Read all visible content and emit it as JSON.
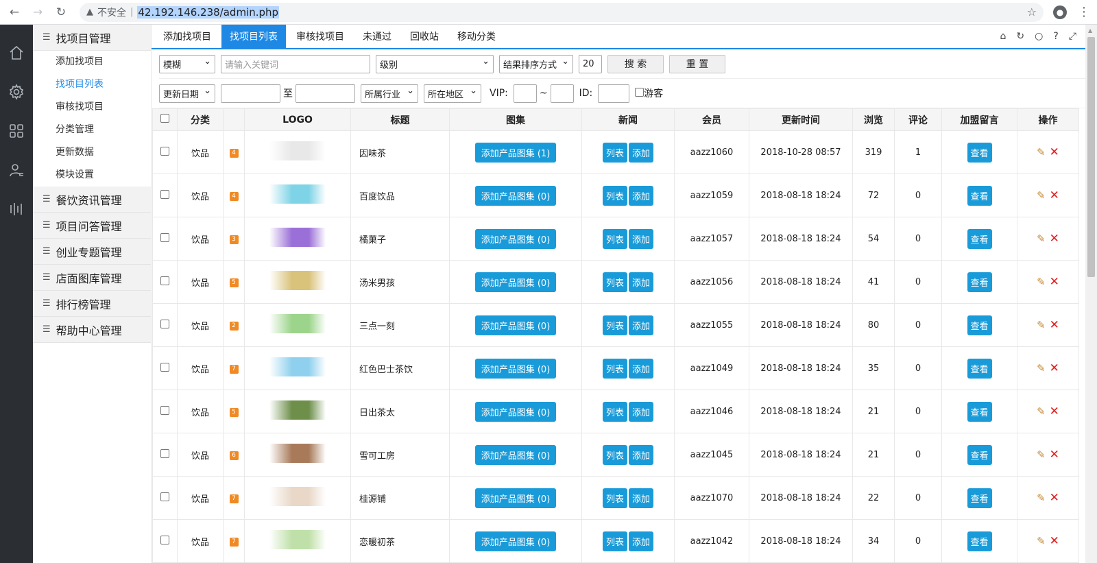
{
  "browser": {
    "insecure_label": "不安全",
    "url": "42.192.146.238/admin.php"
  },
  "iconbar": [
    "home-icon",
    "gear-icon",
    "grid-icon",
    "user-list-icon",
    "bars-icon"
  ],
  "sidebar": {
    "groups": [
      {
        "label": "找项目管理",
        "items": [
          "添加找项目",
          "找项目列表",
          "审核找项目",
          "分类管理",
          "更新数据",
          "模块设置"
        ]
      },
      {
        "label": "餐饮资讯管理"
      },
      {
        "label": "项目问答管理"
      },
      {
        "label": "创业专题管理"
      },
      {
        "label": "店面图库管理"
      },
      {
        "label": "排行榜管理"
      },
      {
        "label": "帮助中心管理"
      }
    ]
  },
  "tabs": [
    "添加找项目",
    "找项目列表",
    "审核找项目",
    "未通过",
    "回收站",
    "移动分类"
  ],
  "filters": {
    "mode": "模糊",
    "keyword_placeholder": "请输入关键词",
    "level": "级别",
    "sort": "结果排序方式",
    "pagesize": "20",
    "search_btn": "搜 索",
    "reset_btn": "重 置",
    "date_field": "更新日期",
    "to_label": "至",
    "industry": "所属行业",
    "region": "所在地区",
    "vip_label": "VIP:",
    "tilde": "~",
    "id_label": "ID:",
    "guest_label": "游客"
  },
  "table": {
    "headers": [
      "分类",
      "LOGO",
      "标题",
      "图集",
      "新闻",
      "会员",
      "更新时间",
      "浏览",
      "评论",
      "加盟留言",
      "操作"
    ],
    "list_label": "列表",
    "add_label": "添加",
    "view_label": "查看",
    "rows": [
      {
        "cat": "饮品",
        "rank": "4",
        "title": "因味茶",
        "gallery": "添加产品图集 (1)",
        "member": "aazz1060",
        "time": "2018-10-28 08:57",
        "views": "319",
        "comments": "1",
        "logo": "#e8e8e8"
      },
      {
        "cat": "饮品",
        "rank": "4",
        "title": "百度饮品",
        "gallery": "添加产品图集 (0)",
        "member": "aazz1059",
        "time": "2018-08-18 18:24",
        "views": "72",
        "comments": "0",
        "logo": "#7fd3e6"
      },
      {
        "cat": "饮品",
        "rank": "3",
        "title": "橘菓子",
        "gallery": "添加产品图集 (0)",
        "member": "aazz1057",
        "time": "2018-08-18 18:24",
        "views": "54",
        "comments": "0",
        "logo": "#9b6fd8"
      },
      {
        "cat": "饮品",
        "rank": "5",
        "title": "汤米男孩",
        "gallery": "添加产品图集 (0)",
        "member": "aazz1056",
        "time": "2018-08-18 18:24",
        "views": "41",
        "comments": "0",
        "logo": "#d9c27a"
      },
      {
        "cat": "饮品",
        "rank": "2",
        "title": "三点一刻",
        "gallery": "添加产品图集 (0)",
        "member": "aazz1055",
        "time": "2018-08-18 18:24",
        "views": "80",
        "comments": "0",
        "logo": "#9bd48a"
      },
      {
        "cat": "饮品",
        "rank": "7",
        "title": "红色巴士茶饮",
        "gallery": "添加产品图集 (0)",
        "member": "aazz1049",
        "time": "2018-08-18 18:24",
        "views": "35",
        "comments": "0",
        "logo": "#8fd0ee"
      },
      {
        "cat": "饮品",
        "rank": "5",
        "title": "日出茶太",
        "gallery": "添加产品图集 (0)",
        "member": "aazz1046",
        "time": "2018-08-18 18:24",
        "views": "21",
        "comments": "0",
        "logo": "#6d8f4a"
      },
      {
        "cat": "饮品",
        "rank": "6",
        "title": "雪可工房",
        "gallery": "添加产品图集 (0)",
        "member": "aazz1045",
        "time": "2018-08-18 18:24",
        "views": "21",
        "comments": "0",
        "logo": "#a87a5a"
      },
      {
        "cat": "饮品",
        "rank": "7",
        "title": "桂源铺",
        "gallery": "添加产品图集 (0)",
        "member": "aazz1070",
        "time": "2018-08-18 18:24",
        "views": "22",
        "comments": "0",
        "logo": "#e9d8c8"
      },
      {
        "cat": "饮品",
        "rank": "7",
        "title": "恋暖初茶",
        "gallery": "添加产品图集 (0)",
        "member": "aazz1042",
        "time": "2018-08-18 18:24",
        "views": "34",
        "comments": "0",
        "logo": "#bfe0a8"
      }
    ]
  }
}
